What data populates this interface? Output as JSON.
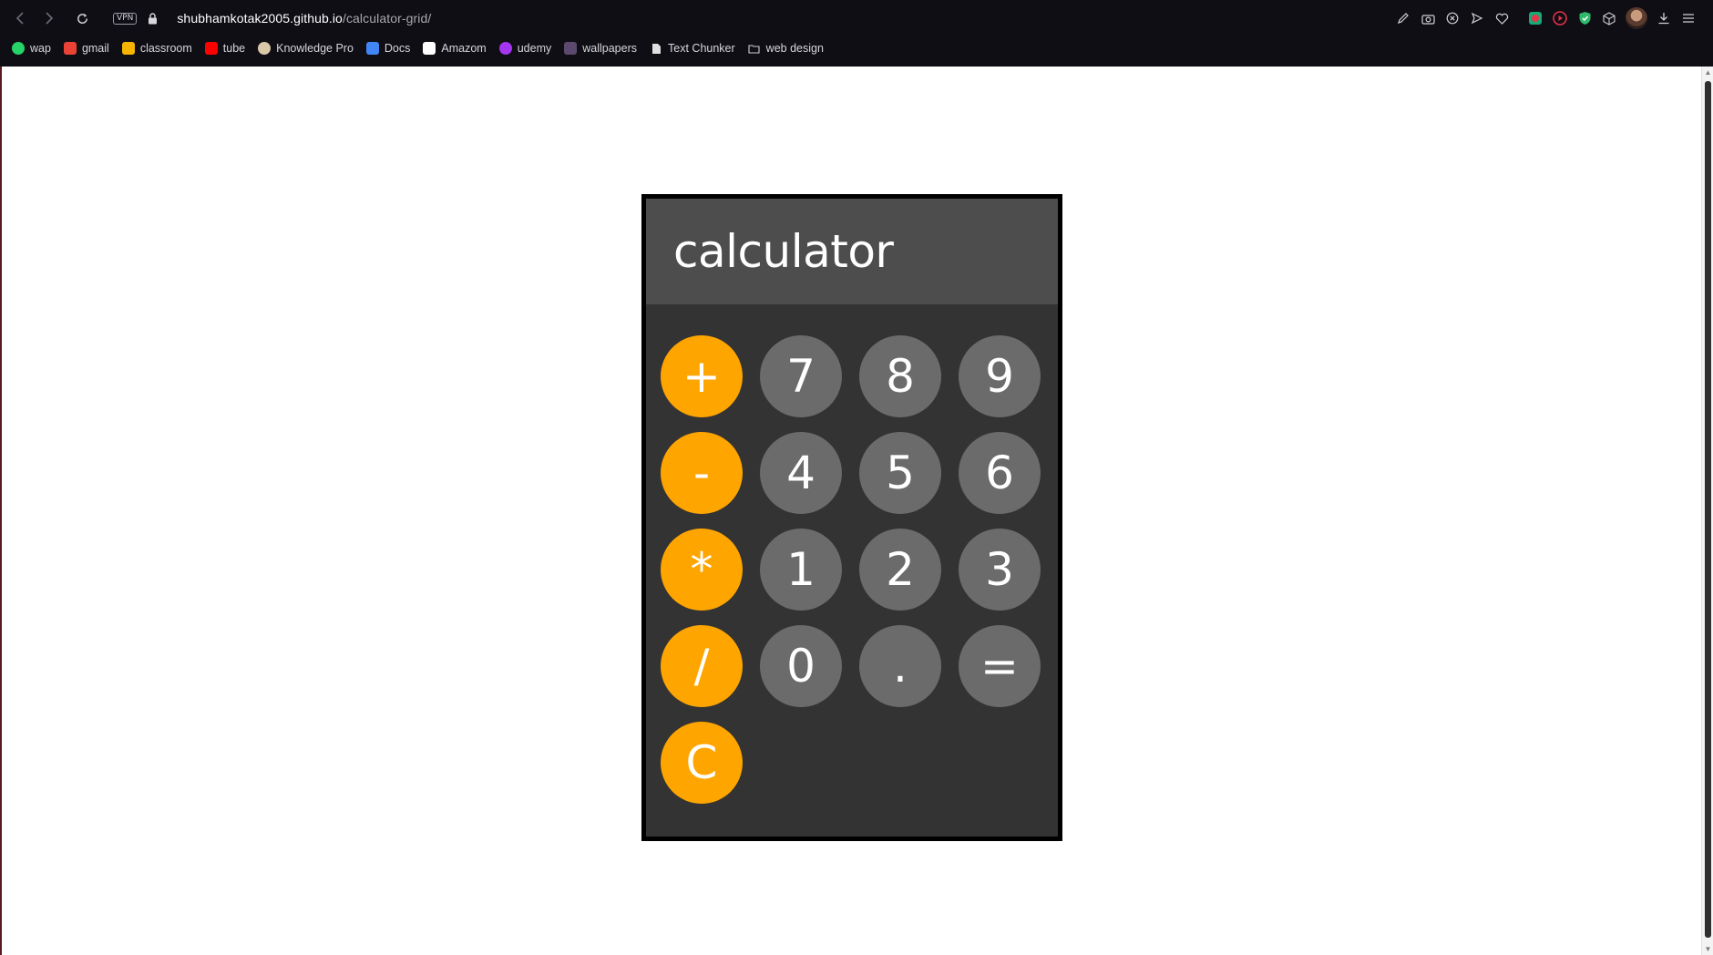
{
  "browser": {
    "vpn_label": "VPN",
    "url_host": "shubhamkotak2005.github.io",
    "url_path": "/calculator-grid/",
    "bookmarks": [
      {
        "label": "wap",
        "icon": "whatsapp-icon",
        "color": "#25d366"
      },
      {
        "label": "gmail",
        "icon": "gmail-icon",
        "color": "#ea4335"
      },
      {
        "label": "classroom",
        "icon": "classroom-icon",
        "color": "#f4b400"
      },
      {
        "label": "tube",
        "icon": "youtube-icon",
        "color": "#ff0000"
      },
      {
        "label": "Knowledge Pro",
        "icon": "knowledge-pro-icon",
        "color": "#d9c9a8"
      },
      {
        "label": "Docs",
        "icon": "docs-icon",
        "color": "#4285f4"
      },
      {
        "label": "Amazom",
        "icon": "amazon-icon",
        "color": "#ffffff"
      },
      {
        "label": "udemy",
        "icon": "udemy-icon",
        "color": "#a435f0"
      },
      {
        "label": "wallpapers",
        "icon": "wallpapers-icon",
        "color": "#5b4a6e"
      },
      {
        "label": "Text Chunker",
        "icon": "file-icon",
        "color": "#e0e0e0"
      },
      {
        "label": "web design",
        "icon": "folder-icon",
        "color": "#cfcfd4"
      }
    ]
  },
  "calculator": {
    "display": "calculator",
    "keys": [
      "+",
      "7",
      "8",
      "9",
      "-",
      "4",
      "5",
      "6",
      "*",
      "1",
      "2",
      "3",
      "/",
      "0",
      ".",
      "=",
      "C"
    ],
    "colors": {
      "operator": "#ffa500",
      "number": "#6b6b6b",
      "display": "#4d4d4d",
      "body": "#333333"
    }
  }
}
